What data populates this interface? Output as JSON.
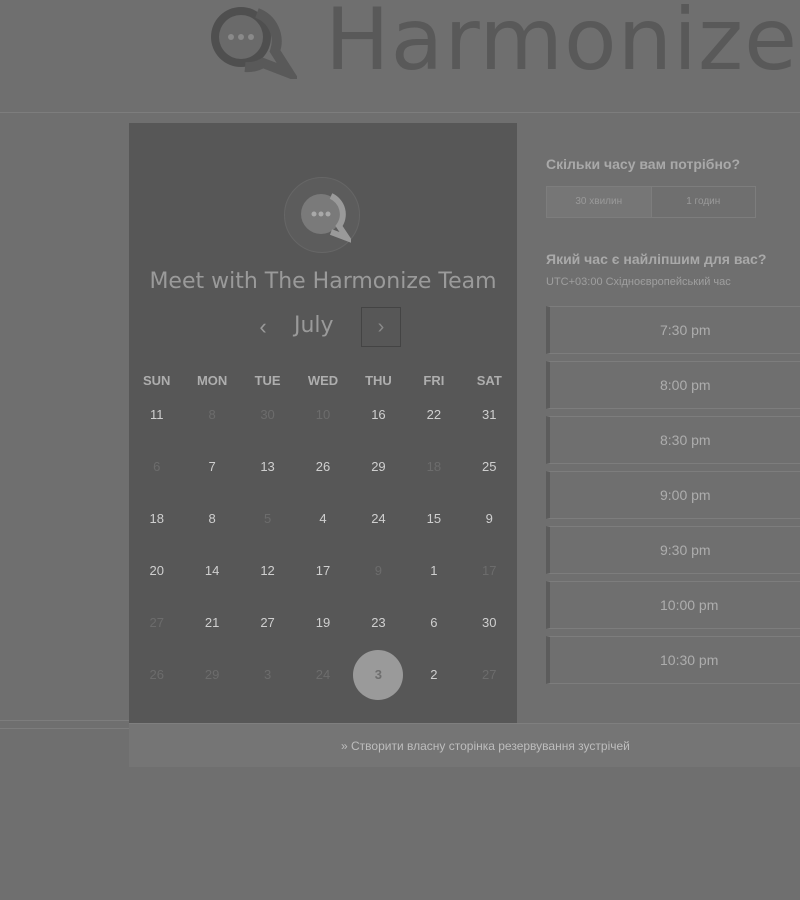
{
  "brand": {
    "name": "Harmonize",
    "logo_icon": "chat-bubble-logo-icon"
  },
  "calendar": {
    "title": "Meet with The Harmonize Team",
    "month": "July",
    "prev_icon": "‹",
    "next_icon": "›",
    "weekdays": [
      "SUN",
      "MON",
      "TUE",
      "WED",
      "THU",
      "FRI",
      "SAT"
    ],
    "days": [
      {
        "n": "11",
        "dim": false
      },
      {
        "n": "8",
        "dim": true
      },
      {
        "n": "30",
        "dim": true
      },
      {
        "n": "10",
        "dim": true
      },
      {
        "n": "16",
        "dim": false
      },
      {
        "n": "22",
        "dim": false
      },
      {
        "n": "31",
        "dim": false
      },
      {
        "n": "6",
        "dim": true
      },
      {
        "n": "7",
        "dim": false
      },
      {
        "n": "13",
        "dim": false
      },
      {
        "n": "26",
        "dim": false
      },
      {
        "n": "29",
        "dim": false
      },
      {
        "n": "18",
        "dim": true
      },
      {
        "n": "25",
        "dim": false
      },
      {
        "n": "18",
        "dim": false
      },
      {
        "n": "8",
        "dim": false
      },
      {
        "n": "5",
        "dim": true
      },
      {
        "n": "4",
        "dim": false
      },
      {
        "n": "24",
        "dim": false
      },
      {
        "n": "15",
        "dim": false
      },
      {
        "n": "9",
        "dim": false
      },
      {
        "n": "20",
        "dim": false
      },
      {
        "n": "14",
        "dim": false
      },
      {
        "n": "12",
        "dim": false
      },
      {
        "n": "17",
        "dim": false
      },
      {
        "n": "9",
        "dim": true
      },
      {
        "n": "1",
        "dim": false
      },
      {
        "n": "17",
        "dim": true
      },
      {
        "n": "27",
        "dim": true
      },
      {
        "n": "21",
        "dim": false
      },
      {
        "n": "27",
        "dim": false
      },
      {
        "n": "19",
        "dim": false
      },
      {
        "n": "23",
        "dim": false
      },
      {
        "n": "6",
        "dim": false
      },
      {
        "n": "30",
        "dim": false
      },
      {
        "n": "26",
        "dim": true
      },
      {
        "n": "29",
        "dim": true
      },
      {
        "n": "3",
        "dim": true
      },
      {
        "n": "24",
        "dim": true
      },
      {
        "n": "3",
        "dim": false,
        "selected": true
      },
      {
        "n": "2",
        "dim": false
      },
      {
        "n": "27",
        "dim": true
      }
    ]
  },
  "duration": {
    "question": "Скільки часу вам потрібно?",
    "options": [
      "30 хвилин",
      "1 годин"
    ],
    "selected": 0
  },
  "times": {
    "question": "Який час є найліпшим для вас?",
    "timezone": "UTC+03:00 Східноєвропейський час",
    "slots": [
      "7:30 pm",
      "8:00 pm",
      "8:30 pm",
      "9:00 pm",
      "9:30 pm",
      "10:00 pm",
      "10:30 pm"
    ]
  },
  "footer": {
    "link": "Створити власну сторінка резервування зустрічей"
  }
}
